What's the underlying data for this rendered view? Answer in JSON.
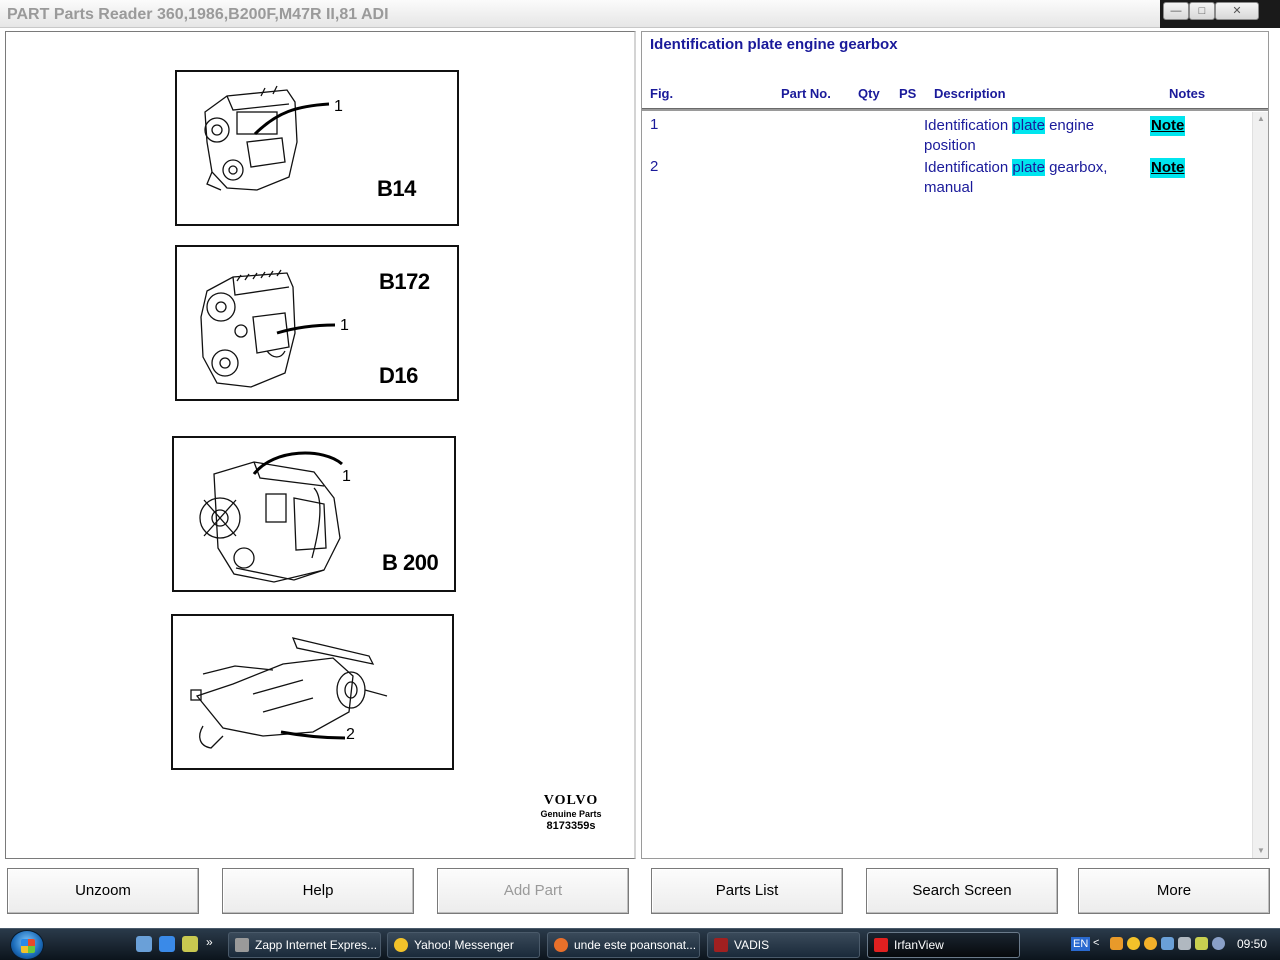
{
  "window": {
    "title": "PART Parts Reader 360,1986,B200F,M47R II,81 ADI",
    "minimize_icon": "minimize-icon",
    "maximize_icon": "maximize-icon",
    "close_icon": "close-icon"
  },
  "illustration": {
    "diagrams": [
      {
        "codes": [
          "B14"
        ],
        "callout": "1"
      },
      {
        "codes": [
          "B172",
          "D16"
        ],
        "callout": "1"
      },
      {
        "codes": [
          "B 200"
        ],
        "callout": "1"
      },
      {
        "codes": [],
        "callout": "2"
      }
    ],
    "logo": {
      "brand": "VOLVO",
      "subtitle": "Genuine Parts",
      "illustration_no": "8173359s"
    }
  },
  "parts_panel": {
    "title": "Identification plate engine gearbox",
    "columns": {
      "fig": "Fig.",
      "part_no": "Part No.",
      "qty": "Qty",
      "ps": "PS",
      "description": "Description",
      "notes": "Notes"
    },
    "rows": [
      {
        "fig": "1",
        "desc_before": "Identification ",
        "desc_highlight": "plate",
        "desc_after": " engine position",
        "note": "Note"
      },
      {
        "fig": "2",
        "desc_before": "Identification ",
        "desc_highlight": "plate",
        "desc_after": " gearbox, manual",
        "note": "Note"
      }
    ],
    "highlight_color": "#00e5ee"
  },
  "buttons": {
    "unzoom": "Unzoom",
    "help": "Help",
    "add_part": "Add Part",
    "parts_list": "Parts List",
    "search_screen": "Search Screen",
    "more": "More"
  },
  "taskbar": {
    "tasks": [
      {
        "label": "Zapp Internet Expres..."
      },
      {
        "label": "Yahoo! Messenger"
      },
      {
        "label": "unde este poansonat..."
      },
      {
        "label": "VADIS"
      },
      {
        "label": "IrfanView"
      }
    ],
    "language": "EN",
    "clock": "09:50"
  }
}
